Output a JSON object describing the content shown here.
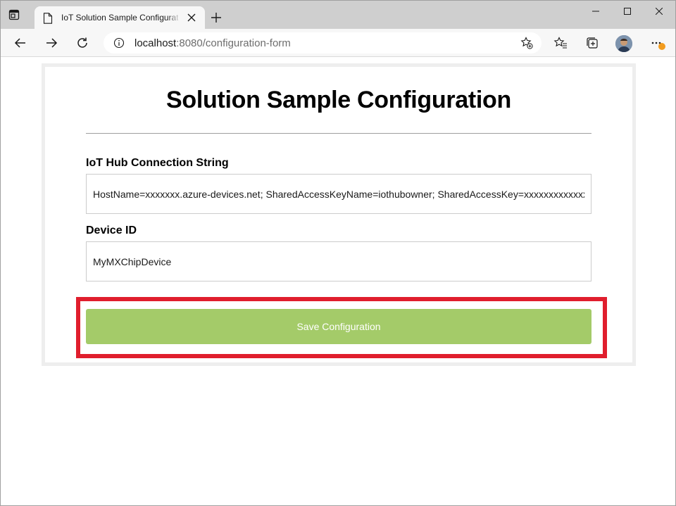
{
  "browser": {
    "tab_title": "IoT Solution Sample Configuration",
    "address": {
      "host": "localhost",
      "path": ":8080/configuration-form"
    },
    "icons": {
      "tab_actions": "tab-actions-icon",
      "page": "page-icon",
      "tab_close": "close-icon",
      "new_tab": "plus-icon",
      "minimize": "minimize-icon",
      "maximize": "maximize-icon",
      "close": "close-icon",
      "back": "arrow-left-icon",
      "forward": "arrow-right-icon",
      "reload": "reload-icon",
      "info": "info-icon",
      "add_favorite": "star-plus-icon",
      "favorites": "favorites-icon",
      "collections": "collections-icon",
      "profile": "avatar",
      "more": "more-icon"
    }
  },
  "form": {
    "title": "Solution Sample Configuration",
    "connection_string": {
      "label": "IoT Hub Connection String",
      "value": "HostName=xxxxxxx.azure-devices.net; SharedAccessKeyName=iothubowner; SharedAccessKey=xxxxxxxxxxxxxxxxxxxxxxxxxxxxxxxxxxxxxxxx"
    },
    "device_id": {
      "label": "Device ID",
      "value": "MyMXChipDevice"
    },
    "save_label": "Save Configuration"
  },
  "colors": {
    "button": "#a4cb69",
    "highlight": "#e01e2d",
    "badge": "#f29c1f"
  }
}
